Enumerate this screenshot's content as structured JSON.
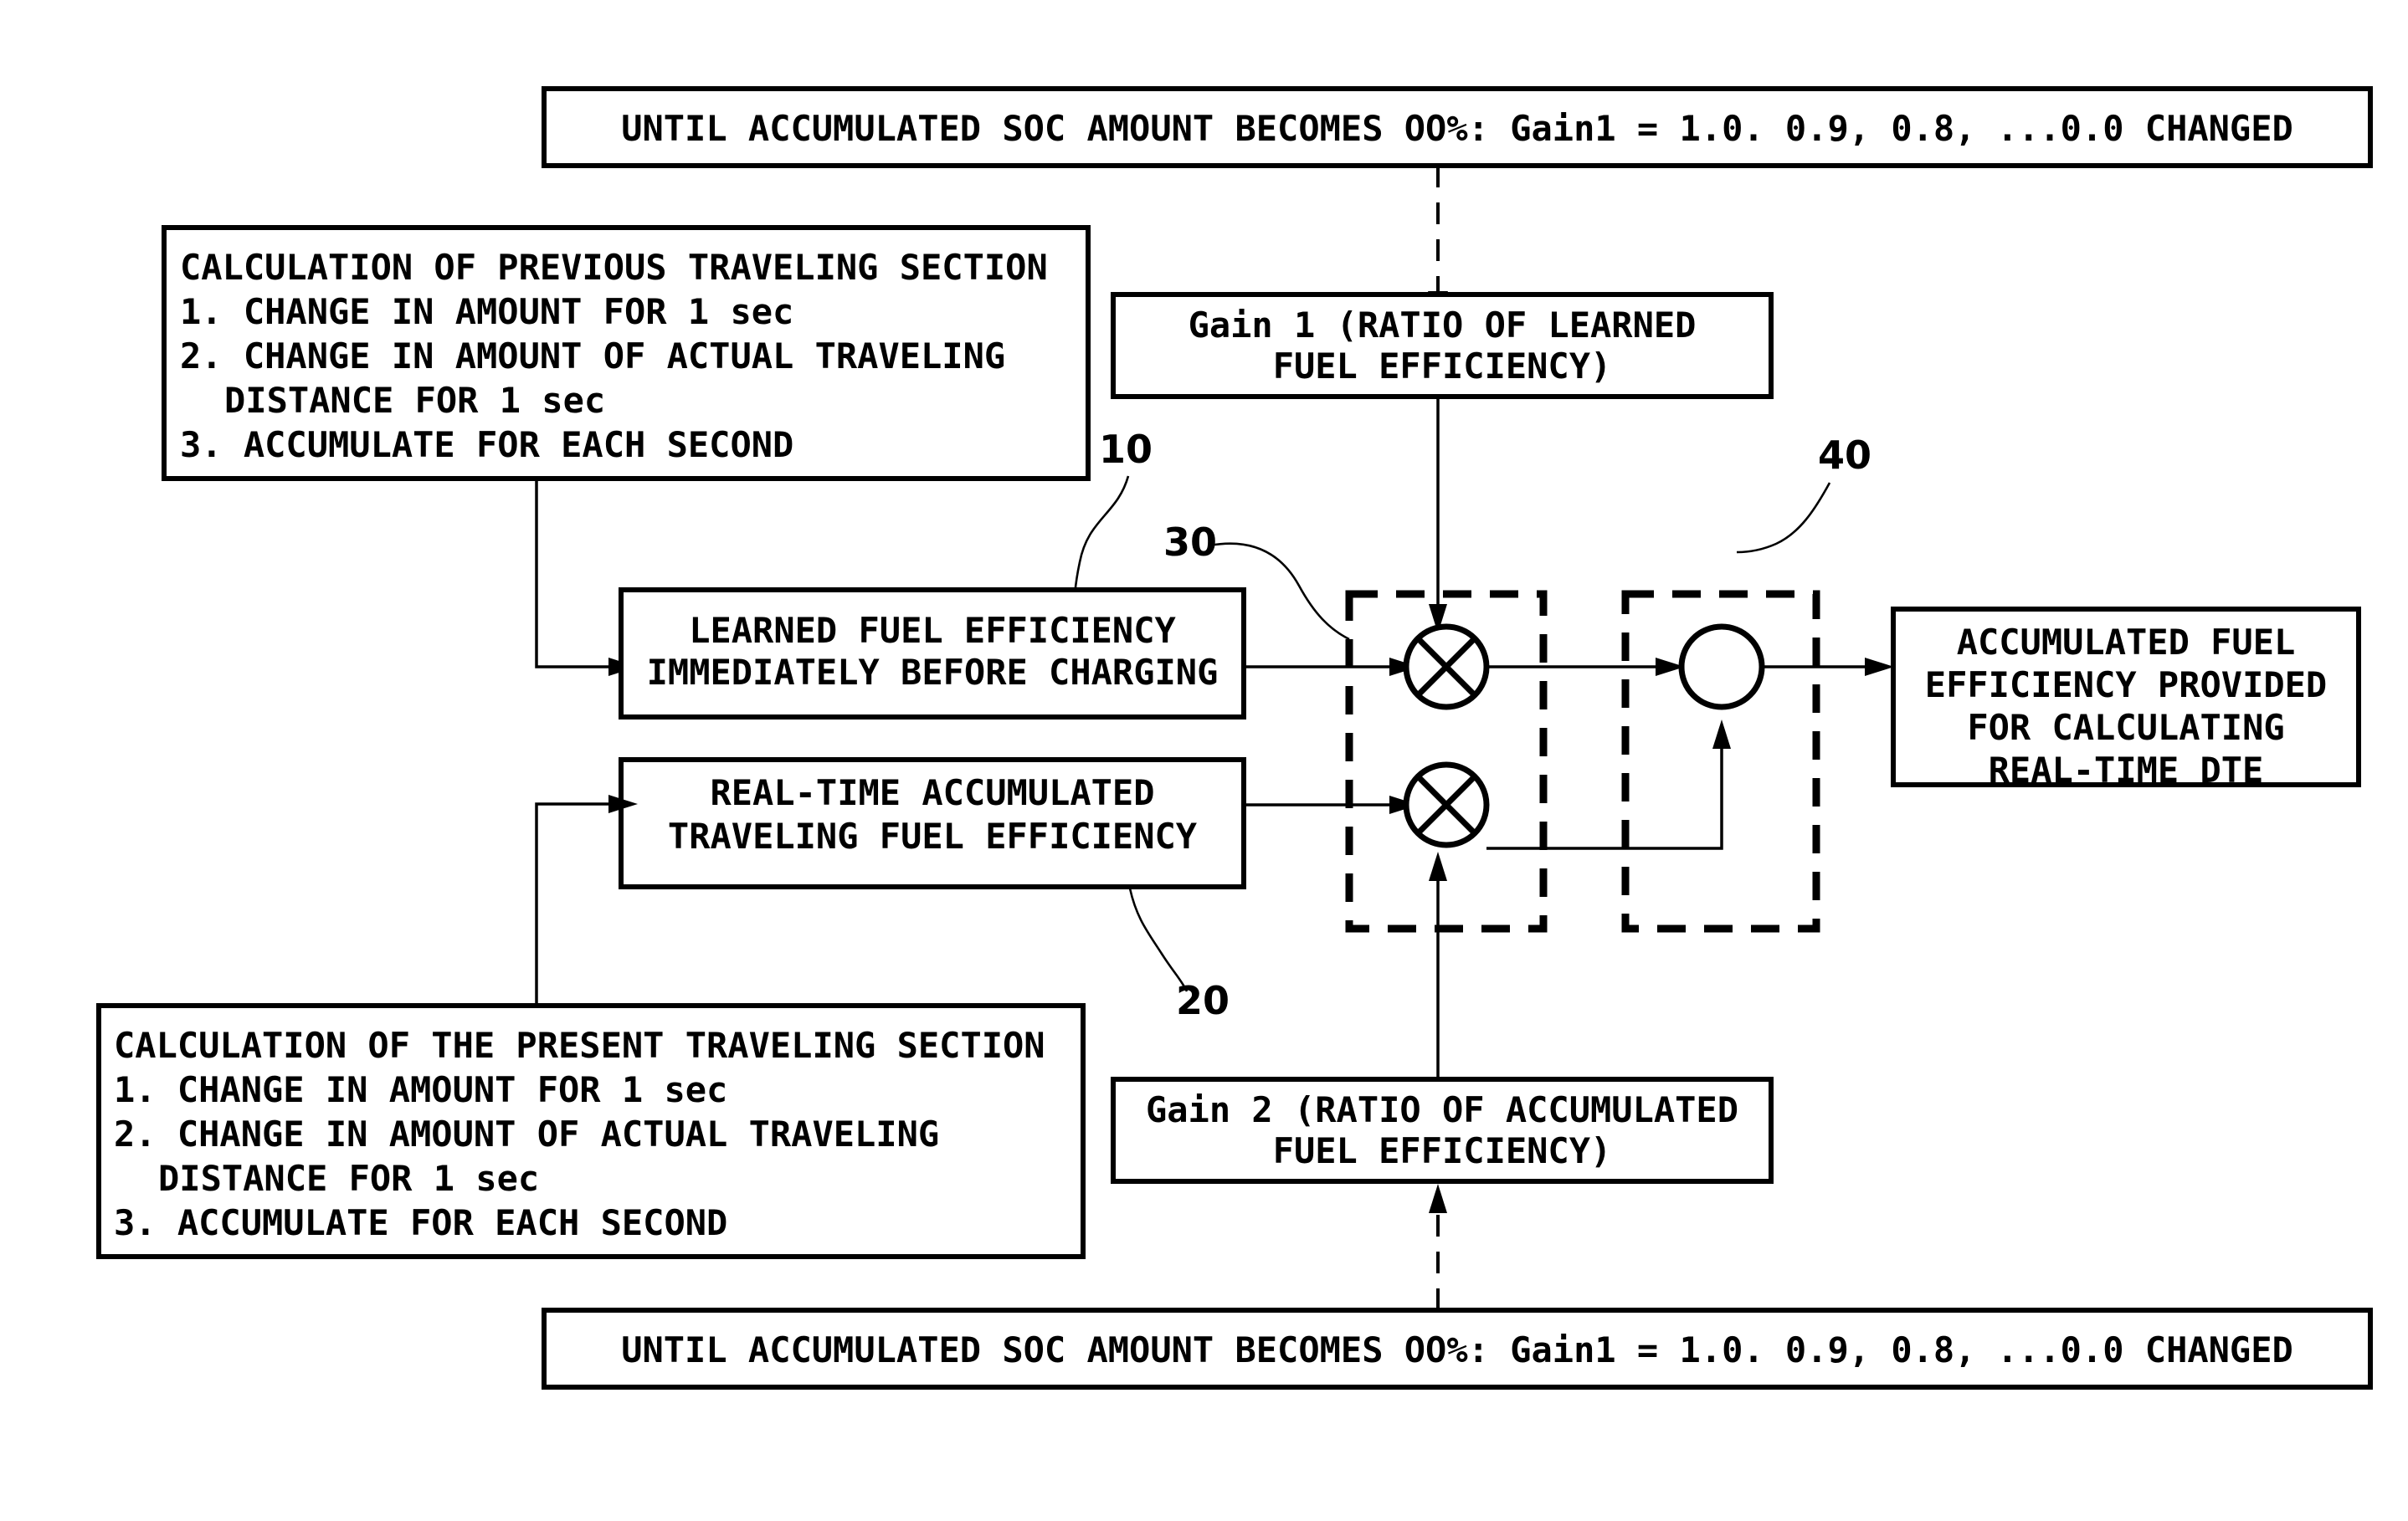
{
  "figure": {
    "title": "Fuel efficiency accumulation block diagram",
    "background_color": "#ffffff",
    "line_color": "#000000"
  },
  "boxes": {
    "top_note": {
      "text": "UNTIL ACCUMULATED SOC AMOUNT BECOMES OO%: Gain1 = 1.0. 0.9, 0.8, ...0.0 CHANGED"
    },
    "bottom_note": {
      "text": "UNTIL ACCUMULATED SOC AMOUNT BECOMES OO%: Gain1 = 1.0. 0.9, 0.8, ...0.0 CHANGED"
    },
    "prev_calc": {
      "heading": "CALCULATION OF PREVIOUS TRAVELING SECTION",
      "line1": "1. CHANGE IN AMOUNT FOR 1 sec",
      "line2": "2. CHANGE IN AMOUNT OF ACTUAL TRAVELING",
      "line3": "DISTANCE FOR 1 sec",
      "line4": "3. ACCUMULATE FOR EACH SECOND"
    },
    "present_calc": {
      "heading": "CALCULATION OF THE PRESENT TRAVELING SECTION",
      "line1": "1. CHANGE IN AMOUNT FOR 1 sec",
      "line2": "2. CHANGE IN AMOUNT OF ACTUAL TRAVELING",
      "line3": "DISTANCE FOR 1 sec",
      "line4": "3. ACCUMULATE FOR EACH SECOND"
    },
    "gain1": {
      "line1": "Gain 1 (RATIO OF LEARNED",
      "line2": "FUEL EFFICIENCY)"
    },
    "gain2": {
      "line1": "Gain 2 (RATIO OF ACCUMULATED",
      "line2": "FUEL EFFICIENCY)"
    },
    "learned_fe": {
      "line1": "LEARNED FUEL EFFICIENCY",
      "line2": "IMMEDIATELY BEFORE CHARGING"
    },
    "realtime_fe": {
      "line1": "REAL-TIME ACCUMULATED",
      "line2": "TRAVELING FUEL EFFICIENCY"
    },
    "output": {
      "line1": "ACCUMULATED FUEL",
      "line2": "EFFICIENCY PROVIDED",
      "line3": "FOR CALCULATING",
      "line4": "REAL-TIME DTE"
    }
  },
  "reference_numerals": {
    "learned_fe": "10",
    "realtime_fe": "20",
    "multiplier_group": "30",
    "summer_group": "40"
  },
  "operators": {
    "multiplier_top": "multiply-operator",
    "multiplier_bottom": "multiply-operator",
    "summer": "sum-operator"
  }
}
